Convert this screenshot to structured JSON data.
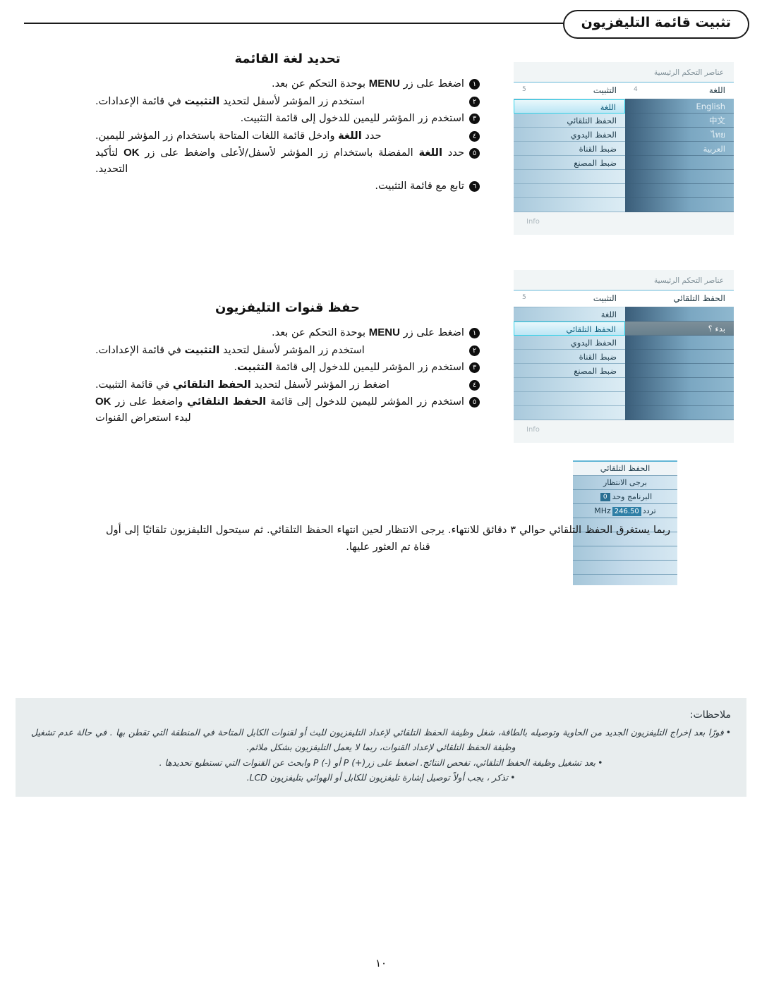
{
  "header": {
    "badge": "تثبيت قائمة التليفزيون"
  },
  "sections": [
    {
      "title": "تحديد لغة القائمة",
      "steps": [
        {
          "num": "١",
          "html": "اضغط على زر <span class=\"kbd\">MENU</span> بوحدة التحكم عن بعد."
        },
        {
          "num": "٢",
          "html": "استخدم زر المؤشر لأسفل لتحديد <b>التثبيت</b> في قائمة الإعدادات."
        },
        {
          "num": "٣",
          "html": "استخدم زر المؤشر لليمين للدخول إلى قائمة التثبيت."
        },
        {
          "num": "٤",
          "html": "حدد <b>اللغة</b> وادخل قائمة اللغات المتاحة باستخدام زر المؤشر لليمين."
        },
        {
          "num": "٥",
          "html": "حدد <b>اللغة</b> المفضلة باستخدام زر المؤشر لأسفل/لأعلى واضغط على زر <span class=\"kbd\">OK</span> لتأكيد التحديد."
        },
        {
          "num": "٦",
          "html": "تابع مع قائمة التثبيت."
        }
      ]
    },
    {
      "title": "حفظ قنوات التليفزيون",
      "steps": [
        {
          "num": "١",
          "html": "اضغط على زر <span class=\"kbd\">MENU</span> بوحدة التحكم عن بعد."
        },
        {
          "num": "٢",
          "html": "استخدم زر المؤشر لأسفل لتحديد <b>التثبيت</b> في قائمة الإعدادات."
        },
        {
          "num": "٣",
          "html": "استخدم زر المؤشر لليمين للدخول إلى قائمة <b>التثبيت</b>."
        },
        {
          "num": "٤",
          "html": "اضغط زر المؤشر لأسفل لتحديد <b>الحفظ التلقائي</b> في قائمة التثبيت."
        },
        {
          "num": "٥",
          "html": "استخدم زر المؤشر لليمين للدخول إلى قائمة <b>الحفظ التلقائي</b> واضغط على زر <span class=\"kbd\">OK</span> لبدء استعراض القنوات"
        }
      ]
    }
  ],
  "paragraph": "ربما يستغرق الحفظ التلقائي حوالي ٣ دقائق للانتهاء. يرجى الانتظار لحين انتهاء الحفظ التلقائي. ثم سيتحول التليفزيون تلقائيًا إلى أول قناة تم العثور عليها.",
  "osd_language": {
    "breadcrumb": "عناصر التحكم الرئيسية",
    "columns": [
      {
        "label": "اللغة",
        "count": "4"
      },
      {
        "label": "التثبيت",
        "count": "5"
      }
    ],
    "left_items": [
      {
        "label": "اللغة",
        "selected": true
      },
      {
        "label": "الحفظ التلقائي",
        "selected": false
      },
      {
        "label": "الحفظ اليدوي",
        "selected": false
      },
      {
        "label": "ضبط القناة",
        "selected": false
      },
      {
        "label": "ضبط المصنع",
        "selected": false
      }
    ],
    "right_items": [
      {
        "label": "English",
        "selected": false
      },
      {
        "label": "中文",
        "selected": false
      },
      {
        "label": "ไทย",
        "selected": false
      },
      {
        "label": "العربية",
        "selected": false
      }
    ],
    "footer": "Info"
  },
  "osd_autostore": {
    "breadcrumb": "عناصر التحكم الرئيسية",
    "columns": [
      {
        "label": "الحفظ التلقائي",
        "count": ""
      },
      {
        "label": "التثبيت",
        "count": "5"
      }
    ],
    "left_items": [
      {
        "label": "اللغة",
        "selected": false
      },
      {
        "label": "الحفظ التلقائي",
        "selected": true
      },
      {
        "label": "الحفظ اليدوي",
        "selected": false
      },
      {
        "label": "ضبط القناة",
        "selected": false
      },
      {
        "label": "ضبط المصنع",
        "selected": false
      }
    ],
    "right_items": [
      {
        "label": "بدء ؟",
        "selected": true
      }
    ],
    "footer": "Info"
  },
  "osd_progress": {
    "title": "الحفظ التلقائي",
    "status": "برجى الانتظار",
    "program_label": "البرنامج وحد",
    "program_value": "0",
    "freq_label": "تردد",
    "freq_value": "246.50",
    "freq_unit": "MHz"
  },
  "notes": {
    "title": "ملاحظات:",
    "items": [
      "فورًا بعد إخراج التليفزيون الجديد من الحاوية وتوصيله بالطاقة، شغل وظيفة الحفظ التلقائي لإعداد التليفزيون للبث أو لقنوات الكابل المتاحة في المنطقة التي تقطن بها . في حالة عدم تشغيل وظيفة الحفظ التلقائي لإعداد القنوات، ربما لا يعمل التليفزيون بشكل ملائم.",
      "بعد تشغيل وظيفة الحفظ التلقائي، تفحص النتائج. اضغط على زر(+) P أو (-) P وابحث عن القنوات التي تستطيع تحديدها .",
      "تذكر ، يجب أولاً توصيل إشارة تليفزيون للكابل أو الهوائي بتليفزيون LCD."
    ]
  },
  "page_number": "١٠"
}
